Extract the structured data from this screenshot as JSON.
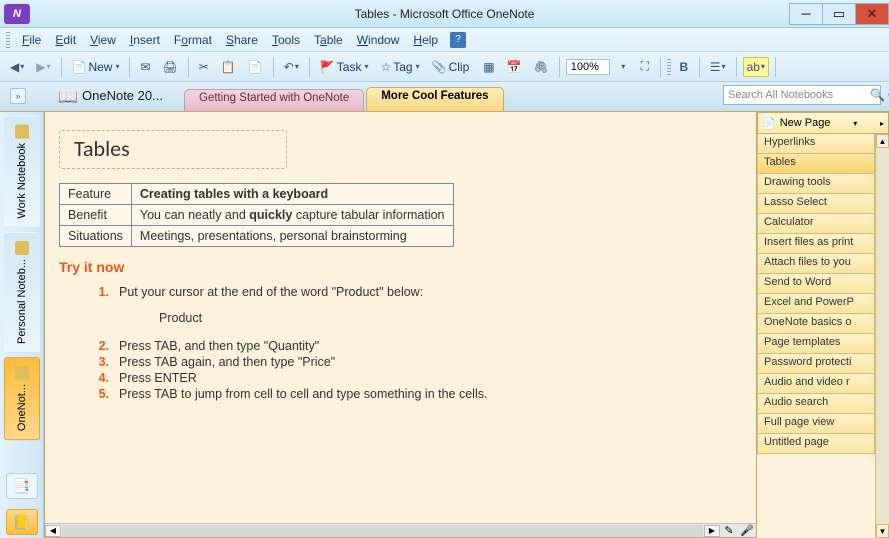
{
  "titlebar": {
    "title": "Tables - Microsoft Office OneNote"
  },
  "menu": {
    "file": "File",
    "edit": "Edit",
    "view": "View",
    "insert": "Insert",
    "format": "Format",
    "share": "Share",
    "tools": "Tools",
    "table": "Table",
    "window": "Window",
    "help": "Help"
  },
  "toolbar": {
    "new": "New",
    "task": "Task",
    "tag": "Tag",
    "clip": "Clip",
    "zoom": "100%",
    "bold": "B"
  },
  "notebook": {
    "title": "OneNote 20..."
  },
  "section_tabs": {
    "t1": "Getting Started with OneNote",
    "t2": "More Cool Features"
  },
  "search": {
    "placeholder": "Search All Notebooks"
  },
  "nbbar": {
    "work": "Work Notebook",
    "personal": "Personal Noteb...",
    "onenote": "OneNot..."
  },
  "page": {
    "title": "Tables",
    "table": {
      "r1c1": "Feature",
      "r1c2": "Creating tables with a keyboard",
      "r2c1": "Benefit",
      "r2c2a": "You can neatly and ",
      "r2c2b": "quickly",
      "r2c2c": " capture tabular information",
      "r3c1": "Situations",
      "r3c2": "Meetings, presentations, personal brainstorming"
    },
    "tryit": "Try it now",
    "steps": {
      "s1": "Put your cursor at the end of the word \"Product\" below:",
      "product": "Product",
      "s2": "Press TAB, and then type \"Quantity\"",
      "s3": "Press TAB again, and then type \"Price\"",
      "s4": "Press ENTER",
      "s5": "Press TAB to jump from cell to cell and type something in the cells."
    }
  },
  "pagelist": {
    "new": "New Page",
    "items": [
      "Hyperlinks",
      "Tables",
      "Drawing tools",
      "Lasso Select",
      "Calculator",
      "Insert files as print",
      "Attach files to you",
      "Send to Word",
      "Excel and PowerP",
      "OneNote basics o",
      "Page templates",
      "Password protecti",
      "Audio and video r",
      "Audio search",
      "Full page view",
      "Untitled page"
    ]
  }
}
